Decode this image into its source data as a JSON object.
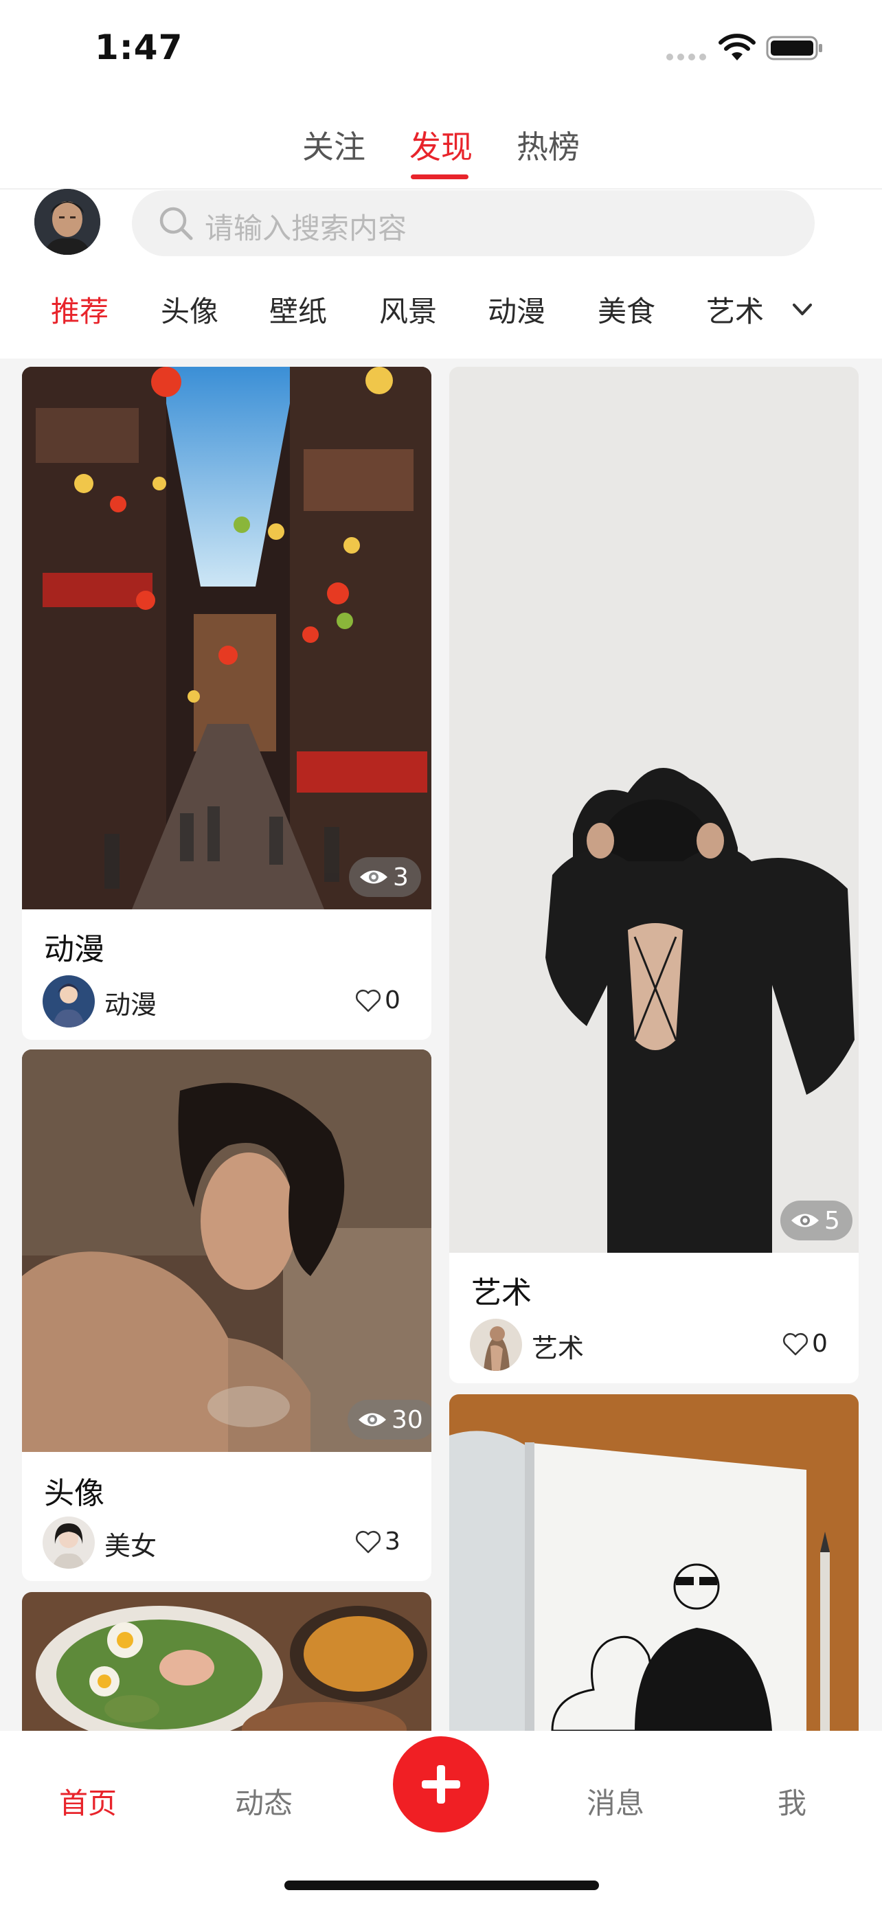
{
  "status_bar": {
    "time": "1:47"
  },
  "top_tabs": [
    {
      "label": "关注",
      "active": false
    },
    {
      "label": "发现",
      "active": true
    },
    {
      "label": "热榜",
      "active": false
    }
  ],
  "search": {
    "placeholder": "请输入搜索内容"
  },
  "categories": [
    "推荐",
    "头像",
    "壁纸",
    "风景",
    "动漫",
    "美食",
    "艺术"
  ],
  "active_category": "推荐",
  "accent_color": "#e8242b",
  "feed": {
    "left": [
      {
        "title": "动漫",
        "author": "动漫",
        "views": "3",
        "likes": "0",
        "image": "city-street-illustration"
      },
      {
        "title": "头像",
        "author": "美女",
        "views": "30",
        "likes": "3",
        "image": "woman-portrait-photo"
      },
      {
        "image": "food-salad-photo"
      }
    ],
    "right": [
      {
        "title": "艺术",
        "author": "艺术",
        "views": "5",
        "likes": "0",
        "image": "black-dress-photo"
      },
      {
        "image": "sketchbook-drawing-photo"
      }
    ]
  },
  "bottom_nav": [
    {
      "label": "首页",
      "active": true
    },
    {
      "label": "动态",
      "active": false
    },
    {
      "label": "消息",
      "active": false
    },
    {
      "label": "我",
      "active": false
    }
  ],
  "icons": [
    "search-icon",
    "chevron-down-icon",
    "eye-icon",
    "heart-icon",
    "plus-icon",
    "wifi-icon",
    "battery-icon",
    "signal-icon"
  ]
}
